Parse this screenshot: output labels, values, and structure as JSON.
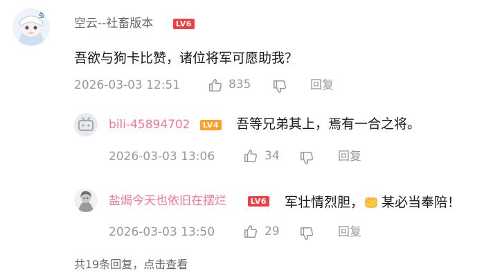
{
  "main_comment": {
    "username": "空云--社畜版本",
    "level": "LV6",
    "text": "吾欲与狗卡比赞，诸位将军可愿助我？",
    "time": "2026-03-03 12:51",
    "likes": "835",
    "reply_label": "回复"
  },
  "replies": [
    {
      "username": "bili-45894702",
      "level": "LV4",
      "text": "吾等兄弟其上，焉有一合之将。",
      "time": "2026-03-03 13:06",
      "likes": "34",
      "reply_label": "回复"
    },
    {
      "username": "盐焗今天也依旧在摆烂",
      "level": "LV6",
      "text_before": "军壮情烈胆，",
      "emoji": "fist-emoji",
      "text_after": "某必当奉陪！",
      "time": "2026-03-03 13:50",
      "likes": "29",
      "reply_label": "回复"
    }
  ],
  "footer": {
    "more_replies": "共19条回复，点击查看"
  },
  "colors": {
    "main_username": "#61666d",
    "reply_username": "#fb7299",
    "meta": "#9499a0",
    "lv6": "#f23e44",
    "lv4": "#ff9f24"
  }
}
